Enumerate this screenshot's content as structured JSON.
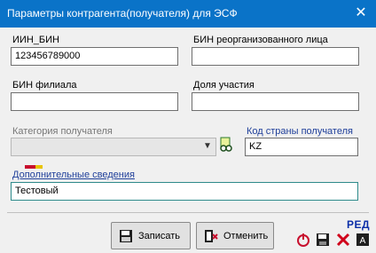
{
  "window": {
    "title": "Параметры контрагента(получателя) для ЭСФ",
    "close_glyph": "✕"
  },
  "form": {
    "iin_bin": {
      "label": "ИИН_БИН",
      "value": "123456789000"
    },
    "bin_reorg": {
      "label": "БИН реорганизованного лица",
      "value": ""
    },
    "bin_branch": {
      "label": "БИН филиала",
      "value": ""
    },
    "share": {
      "label": "Доля участия",
      "value": ""
    },
    "recipient_category": {
      "label": "Категория получателя",
      "value": ""
    },
    "country_code": {
      "label": "Код страны получателя",
      "value": "KZ"
    },
    "additional_info": {
      "label": "Дополнительные сведения",
      "value": "Тестовый"
    }
  },
  "buttons": {
    "save": "Записать",
    "cancel": "Отменить"
  },
  "toolbar": {
    "mode_tag": "РЕД"
  },
  "icons": {
    "close": "close-icon",
    "search": "search-glasses-icon",
    "save": "save-document-icon",
    "cancel": "cancel-exit-icon",
    "power": "power-icon",
    "disk": "floppy-disk-icon",
    "delete": "red-x-icon",
    "font": "font-settings-icon"
  },
  "colors": {
    "titlebar": "#0a73c8",
    "accent_label": "#1f3f9a",
    "field_focus": "#2f8b8b"
  }
}
